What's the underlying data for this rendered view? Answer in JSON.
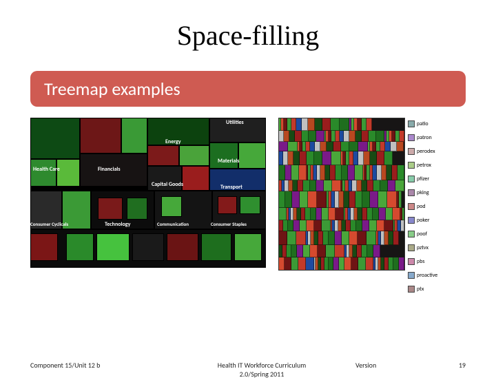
{
  "title": "Space-filling",
  "subtitle": "Treemap examples",
  "treemap1": {
    "sectors": [
      "Health Care",
      "Financials",
      "Energy",
      "Utilities",
      "Materials",
      "Capital Goods",
      "Transport",
      "Consumer Cyclicals",
      "Technology",
      "Communication",
      "Consumer Staples"
    ]
  },
  "treemap2": {
    "legend": [
      "patio",
      "patron",
      "perodex",
      "petrox",
      "pfizer",
      "pking",
      "pod",
      "poker",
      "poof",
      "pztvx",
      "pbs",
      "proactive",
      "ptx"
    ]
  },
  "footer": {
    "left": "Component 15/Unit 12 b",
    "center_line1": "Health IT Workforce Curriculum",
    "center_line2": "2.0/Spring 2011",
    "version": "Version",
    "page": "19"
  }
}
